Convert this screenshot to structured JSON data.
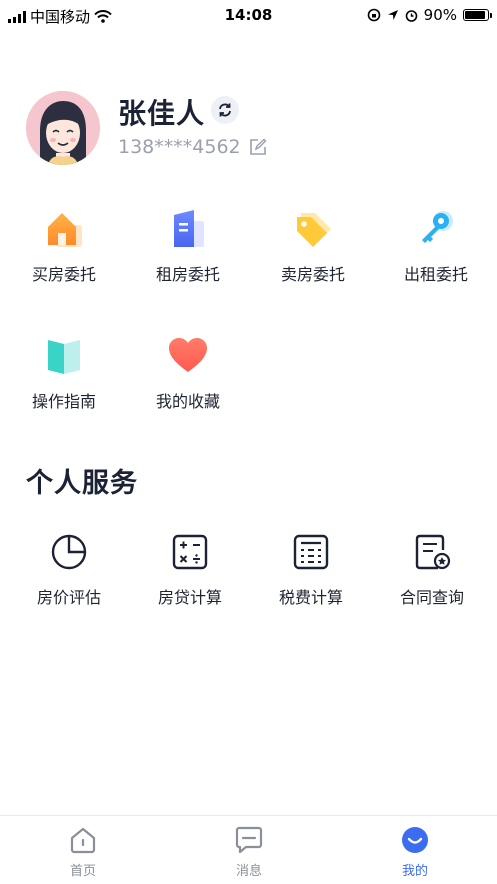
{
  "status_bar": {
    "carrier": "中国移动",
    "time": "14:08",
    "battery": "90%",
    "battery_level": 0.9
  },
  "profile": {
    "name": "张佳人",
    "phone": "138****4562"
  },
  "entrust": [
    {
      "label": "买房委托",
      "icon": "house-icon"
    },
    {
      "label": "租房委托",
      "icon": "building-icon"
    },
    {
      "label": "卖房委托",
      "icon": "price-tag-icon"
    },
    {
      "label": "出租委托",
      "icon": "key-icon"
    },
    {
      "label": "操作指南",
      "icon": "book-icon"
    },
    {
      "label": "我的收藏",
      "icon": "heart-icon"
    }
  ],
  "services": {
    "title": "个人服务",
    "items": [
      {
        "label": "房价评估",
        "icon": "pie-chart-icon"
      },
      {
        "label": "房贷计算",
        "icon": "calculator-icon"
      },
      {
        "label": "税费计算",
        "icon": "tax-table-icon"
      },
      {
        "label": "合同查询",
        "icon": "contract-search-icon"
      }
    ]
  },
  "tabbar": [
    {
      "label": "首页",
      "icon": "home-icon"
    },
    {
      "label": "消息",
      "icon": "message-icon"
    },
    {
      "label": "我的",
      "icon": "mine-icon",
      "active": true
    }
  ],
  "colors": {
    "accent": "#3a6df0",
    "text": "#1f2433",
    "muted": "#9aa0ad"
  }
}
